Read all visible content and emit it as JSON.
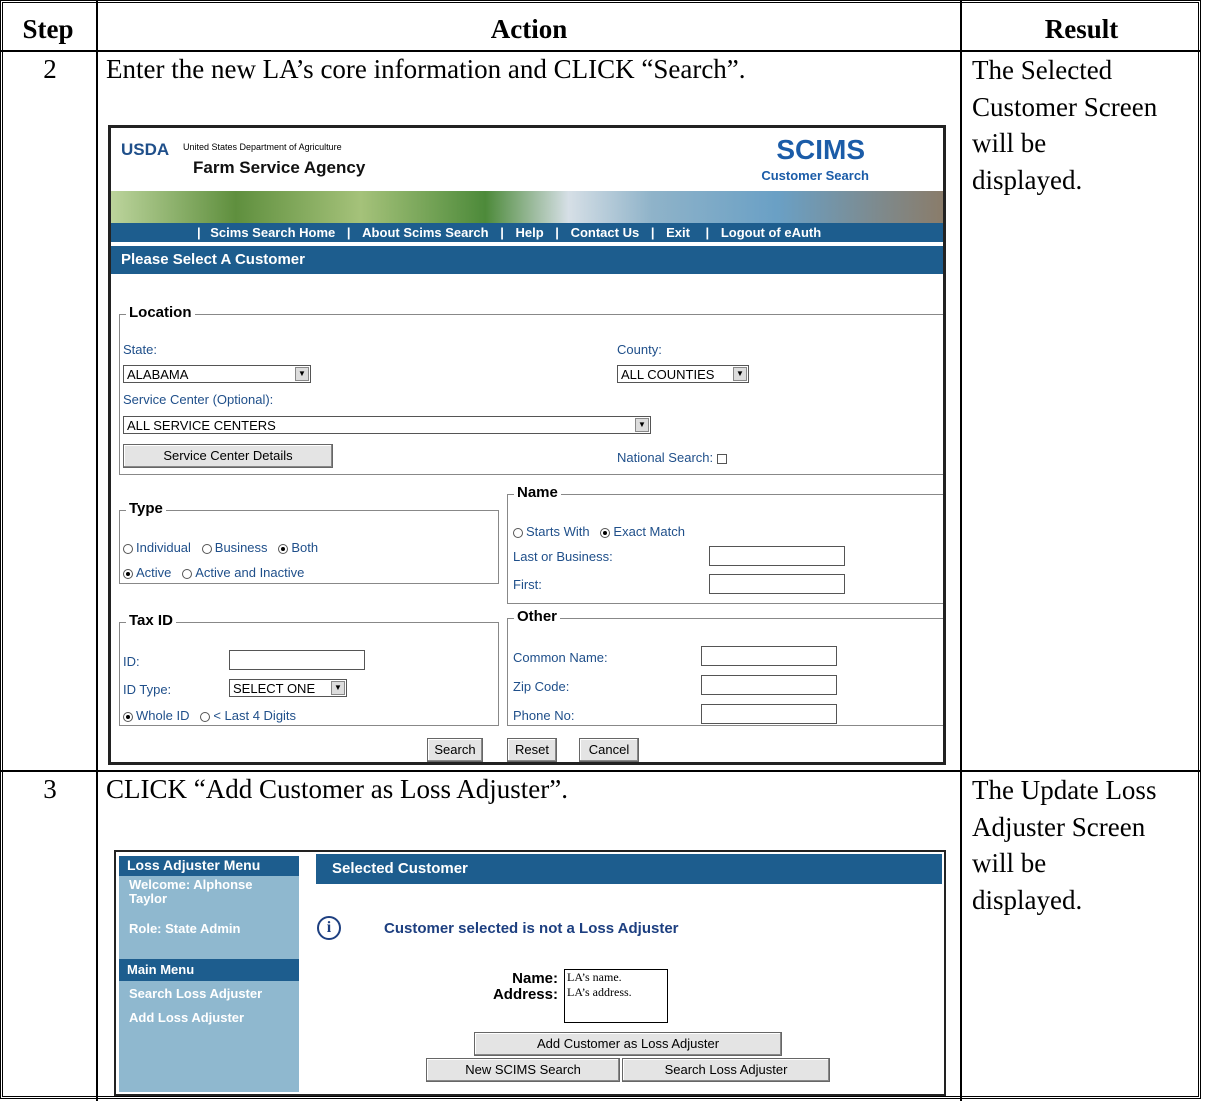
{
  "table": {
    "headers": [
      "Step",
      "Action",
      "Result"
    ],
    "rows": [
      {
        "step": "2",
        "action": "Enter the new LA’s core information and CLICK “Search”.",
        "result": [
          "The Selected",
          "Customer Screen",
          "will be",
          "displayed."
        ]
      },
      {
        "step": "3",
        "action": "CLICK “Add Customer as Loss Adjuster”.",
        "result": [
          "The Update Loss",
          "Adjuster Screen",
          "will be",
          "displayed."
        ]
      }
    ]
  },
  "scims": {
    "usda_logo": "USDA",
    "usda_department": "United States Department of Agriculture",
    "agency": "Farm Service Agency",
    "app_title": "SCIMS",
    "app_subtitle": "Customer Search",
    "nav": [
      "Scims Search Home",
      "About Scims Search",
      "Help",
      "Contact Us",
      "Exit",
      "Logout of eAuth"
    ],
    "section_title": "Please Select A Customer",
    "location": {
      "legend": "Location",
      "state_label": "State:",
      "state_value": "ALABAMA",
      "county_label": "County:",
      "county_value": "ALL COUNTIES",
      "service_center_label": "Service Center (Optional):",
      "service_center_value": "ALL SERVICE CENTERS",
      "service_center_details_button": "Service Center Details",
      "national_search_label": "National Search:"
    },
    "type": {
      "legend": "Type",
      "options_row1": [
        "Individual",
        "Business",
        "Both"
      ],
      "options_row2": [
        "Active",
        "Active and Inactive"
      ]
    },
    "name": {
      "legend": "Name",
      "options": [
        "Starts With",
        "Exact Match"
      ],
      "last_label": "Last or Business:",
      "first_label": "First:"
    },
    "taxid": {
      "legend": "Tax ID",
      "id_label": "ID:",
      "idtype_label": "ID Type:",
      "idtype_value": "SELECT ONE",
      "options": [
        "Whole ID",
        "< Last 4 Digits"
      ]
    },
    "other": {
      "legend": "Other",
      "common_label": "Common Name:",
      "zip_label": "Zip Code:",
      "phone_label": "Phone No:"
    },
    "buttons": [
      "Search",
      "Reset",
      "Cancel"
    ]
  },
  "la": {
    "menu_title": "Loss Adjuster Menu",
    "welcome": "Welcome: Alphonse Taylor",
    "role": "Role: State Admin",
    "main_menu": "Main Menu",
    "items": [
      "Search Loss Adjuster",
      "Add Loss Adjuster"
    ],
    "panel_title": "Selected Customer",
    "message": "Customer selected is not a Loss Adjuster",
    "name_label": "Name:",
    "address_label": "Address:",
    "name_value": "LA’s name.",
    "address_value": "LA’s address.",
    "add_button": "Add Customer as Loss Adjuster",
    "new_search_button": "New SCIMS Search",
    "search_la_button": "Search Loss Adjuster"
  }
}
